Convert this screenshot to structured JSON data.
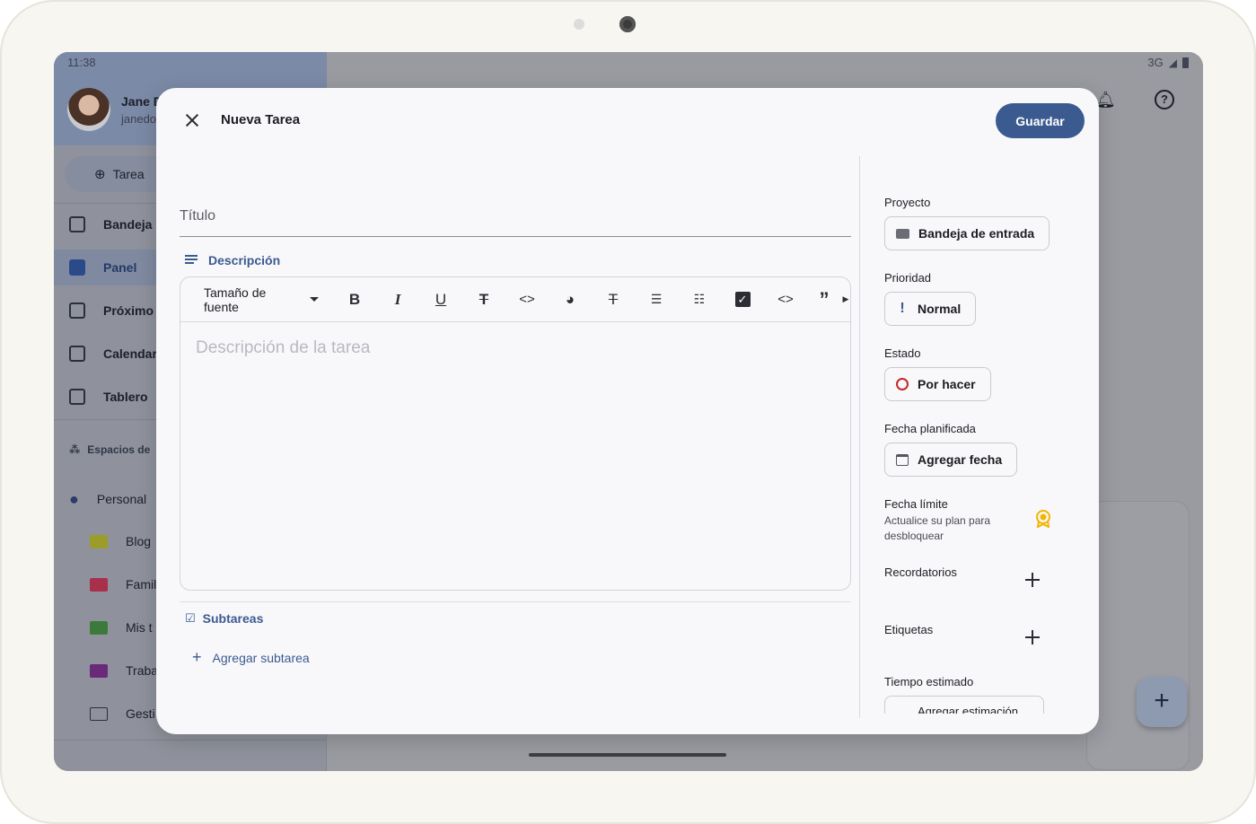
{
  "status": {
    "time": "11:38",
    "network": "3G"
  },
  "user": {
    "name": "Jane D",
    "email": "janedo"
  },
  "sidebar": {
    "new_task": "Tarea",
    "items": [
      "Bandeja",
      "Panel",
      "Próximo",
      "Calendar",
      "Tablero"
    ],
    "spaces_title": "Espacios de",
    "spaces": [
      "Personal",
      "Blog",
      "Famil",
      "Mis t",
      "Traba",
      "Gesti"
    ]
  },
  "dialog": {
    "title": "Nueva Tarea",
    "save": "Guardar",
    "title_placeholder": "Título",
    "description_label": "Descripción",
    "font_size": "Tamaño de fuente",
    "description_placeholder": "Descripción de la tarea",
    "subtasks_label": "Subtareas",
    "add_subtask": "Agregar subtarea",
    "toolbar_buttons": [
      "B",
      "I",
      "U",
      "S",
      "code",
      "palette",
      "clear-format",
      "numbered-list",
      "bullet-list",
      "checkbox",
      "code-block",
      "quote"
    ]
  },
  "properties": {
    "project_label": "Proyecto",
    "project_value": "Bandeja de entrada",
    "priority_label": "Prioridad",
    "priority_value": "Normal",
    "status_label": "Estado",
    "status_value": "Por hacer",
    "planned_label": "Fecha planificada",
    "planned_value": "Agregar fecha",
    "deadline_label": "Fecha límite",
    "deadline_note": "Actualice su plan para desbloquear",
    "reminders_label": "Recordatorios",
    "tags_label": "Etiquetas",
    "estimate_label": "Tiempo estimado",
    "estimate_value": "Agregar estimación"
  },
  "colors": {
    "accent": "#3b5a8f",
    "status_circle": "#c62828",
    "badge": "#f4b400"
  }
}
